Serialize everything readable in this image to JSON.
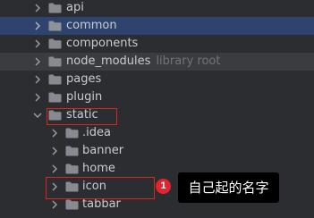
{
  "tree": {
    "items": [
      {
        "label": "api",
        "hint": "",
        "depth": 1,
        "expanded": false,
        "state": ""
      },
      {
        "label": "common",
        "hint": "",
        "depth": 1,
        "expanded": false,
        "state": "selected"
      },
      {
        "label": "components",
        "hint": "",
        "depth": 1,
        "expanded": false,
        "state": ""
      },
      {
        "label": "node_modules",
        "hint": "library root",
        "depth": 1,
        "expanded": false,
        "state": "hover"
      },
      {
        "label": "pages",
        "hint": "",
        "depth": 1,
        "expanded": false,
        "state": ""
      },
      {
        "label": "plugin",
        "hint": "",
        "depth": 1,
        "expanded": false,
        "state": ""
      },
      {
        "label": "static",
        "hint": "",
        "depth": 1,
        "expanded": true,
        "state": ""
      },
      {
        "label": ".idea",
        "hint": "",
        "depth": 2,
        "expanded": false,
        "state": ""
      },
      {
        "label": "banner",
        "hint": "",
        "depth": 2,
        "expanded": false,
        "state": ""
      },
      {
        "label": "home",
        "hint": "",
        "depth": 2,
        "expanded": false,
        "state": ""
      },
      {
        "label": "icon",
        "hint": "",
        "depth": 2,
        "expanded": false,
        "state": ""
      },
      {
        "label": "tabbar",
        "hint": "",
        "depth": 2,
        "expanded": false,
        "state": ""
      }
    ]
  },
  "annotation": {
    "badge_number": "1",
    "callout_text": "自己起的名字",
    "highlight_color": "#d9261c"
  },
  "icons": {
    "chevron_collapsed": "chevron-right-icon",
    "chevron_expanded": "chevron-down-icon",
    "folder": "folder-icon"
  },
  "colors": {
    "background": "#2b2d30",
    "selected_row": "#2e436e",
    "folder": "#878b91",
    "hint_text": "#6f737a"
  }
}
